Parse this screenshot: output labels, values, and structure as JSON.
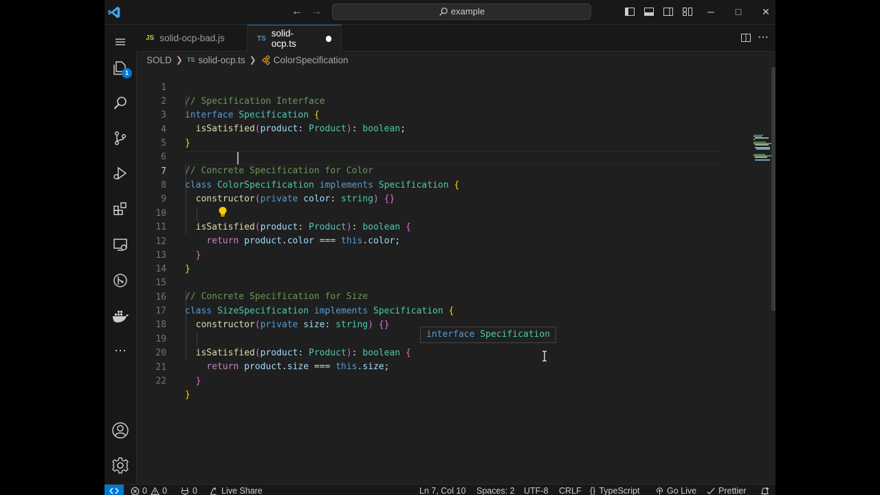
{
  "titlebar": {
    "search_text": "example",
    "back_label": "←",
    "forward_label": "→"
  },
  "tabs": [
    {
      "lang": "JS",
      "label": "solid-ocp-bad.js",
      "active": false
    },
    {
      "lang": "TS",
      "label": "solid-ocp.ts",
      "active": true,
      "dirty": true
    }
  ],
  "breadcrumb": {
    "folder": "SOLD",
    "file_lang": "TS",
    "file": "solid-ocp.ts",
    "symbol": "ColorSpecification"
  },
  "activity": {
    "explorer_badge": "1"
  },
  "editor": {
    "current_line": 7,
    "line_numbers": [
      "1",
      "2",
      "3",
      "4",
      "5",
      "6",
      "7",
      "8",
      "9",
      "10",
      "11",
      "12",
      "13",
      "14",
      "15",
      "16",
      "17",
      "18",
      "19",
      "20",
      "21",
      "22"
    ],
    "lines": [
      "// Specification Interface",
      "interface Specification {",
      "  isSatisfied(product: Product): boolean;",
      "}",
      "",
      "// Concrete Specification for Color",
      "class ColorSpecification implements Specification {",
      "  constructor(private color: string) {}",
      "",
      "  isSatisfied(product: Product): boolean {",
      "    return product.color === this.color;",
      "  }",
      "}",
      "",
      "// Concrete Specification for Size",
      "class SizeSpecification implements Specification {",
      "  constructor(private size: string) {}",
      "",
      "  isSatisfied(product: Product): boolean {",
      "    return product.size === this.size;",
      "  }",
      "}"
    ],
    "hover_text": "interface Specification"
  },
  "statusbar": {
    "errors": "0",
    "warnings": "0",
    "ports": "0",
    "live_share": "Live Share",
    "position": "Ln 7, Col 10",
    "spaces": "Spaces: 2",
    "encoding": "UTF-8",
    "eol": "CRLF",
    "language": "TypeScript",
    "go_live": "Go Live",
    "prettier": "Prettier"
  },
  "colors": {
    "accent": "#0078d4",
    "keyword": "#569cd6",
    "type": "#4ec9b0",
    "function": "#dcdcaa",
    "param": "#9cdcfe",
    "comment": "#6a9955"
  }
}
